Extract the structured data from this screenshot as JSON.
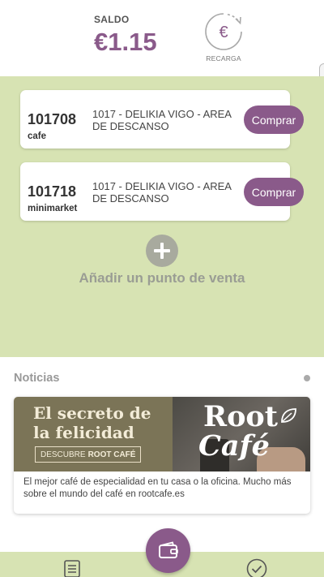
{
  "balance": {
    "label": "SALDO",
    "amount": "€1.15",
    "recharge_label": "RECARGA",
    "recharge_icon": "euro-refresh-icon"
  },
  "points_of_sale": [
    {
      "code": "101708",
      "type": "cafe",
      "name": "1017 - DELIKIA VIGO - AREA DE DESCANSO",
      "button_label": "Comprar"
    },
    {
      "code": "101718",
      "type": "minimarket",
      "name": "1017 - DELIKIA VIGO - AREA DE DESCANSO",
      "button_label": "Comprar"
    }
  ],
  "add_point": {
    "icon": "plus-icon",
    "label": "Añadir un punto de venta"
  },
  "news": {
    "title": "Noticias",
    "item": {
      "banner_headline_1": "El secreto de",
      "banner_headline_2": "la felicidad",
      "banner_cta_prefix": "DESCUBRE",
      "banner_cta_brand": "ROOT CAFÉ",
      "brand_line_1": "Root",
      "brand_line_2": "Café",
      "text": "El mejor café de especialidad en tu casa o la oficina. Mucho más sobre el mundo del café en rootcafe.es"
    }
  },
  "bottom_nav": {
    "left_icon": "document-list-icon",
    "center_icon": "wallet-icon",
    "right_icon": "check-circle-icon"
  },
  "colors": {
    "accent": "#8a5a8a",
    "section_bg": "#d7e3b3",
    "add_gray": "#9a9d94"
  }
}
